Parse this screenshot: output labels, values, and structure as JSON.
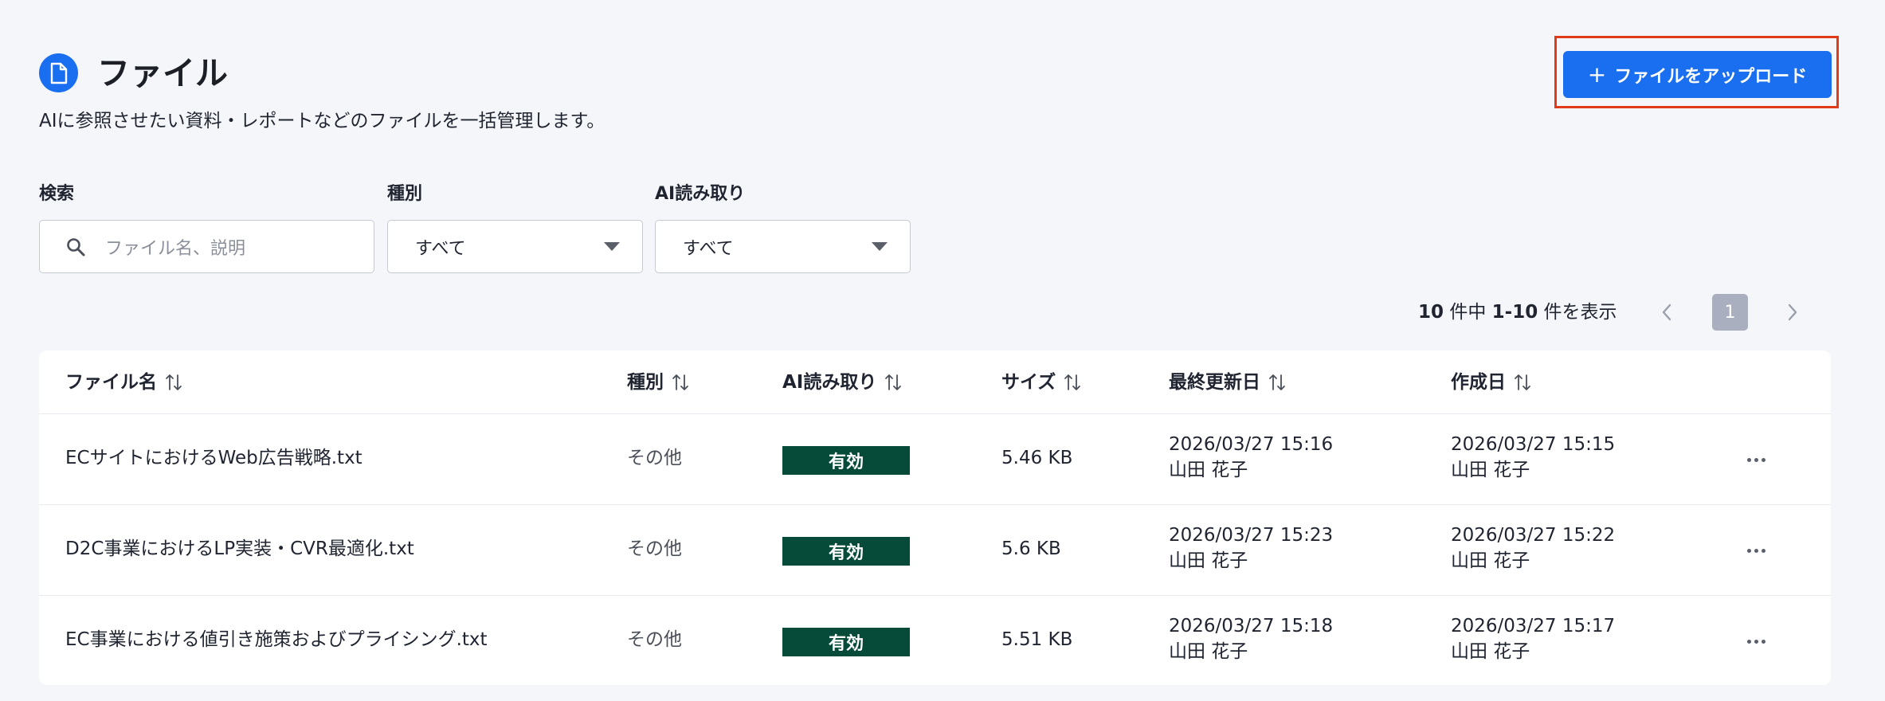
{
  "header": {
    "title": "ファイル",
    "subtitle": "AIに参照させたい資料・レポートなどのファイルを一括管理します。",
    "upload_label": "ファイルをアップロード",
    "upload_plus": "+",
    "icon": "document-icon",
    "accent_color": "#1a6ef0",
    "highlight_color": "#e23b1a"
  },
  "filters": {
    "search_label": "検索",
    "search_placeholder": "ファイル名、説明",
    "type_label": "種別",
    "type_value": "すべて",
    "ai_label": "AI読み取り",
    "ai_value": "すべて"
  },
  "pagination": {
    "total": "10",
    "count_mid": " 件中 ",
    "range": "1-10",
    "count_suffix": " 件を表示",
    "current_page": "1"
  },
  "table": {
    "columns": [
      "ファイル名",
      "種別",
      "AI読み取り",
      "サイズ",
      "最終更新日",
      "作成日"
    ],
    "rows": [
      {
        "name": "ECサイトにおけるWeb広告戦略.txt",
        "type": "その他",
        "ai": "有効",
        "size": "5.46 KB",
        "updated": "2026/03/27 15:16",
        "updated_by": "山田 花子",
        "created": "2026/03/27 15:15",
        "created_by": "山田 花子"
      },
      {
        "name": "D2C事業におけるLP実装・CVR最適化.txt",
        "type": "その他",
        "ai": "有効",
        "size": "5.6 KB",
        "updated": "2026/03/27 15:23",
        "updated_by": "山田 花子",
        "created": "2026/03/27 15:22",
        "created_by": "山田 花子"
      },
      {
        "name": "EC事業における値引き施策およびプライシング.txt",
        "type": "その他",
        "ai": "有効",
        "size": "5.51 KB",
        "updated": "2026/03/27 15:18",
        "updated_by": "山田 花子",
        "created": "2026/03/27 15:17",
        "created_by": "山田 花子"
      }
    ],
    "badge_color": "#064a3a"
  }
}
